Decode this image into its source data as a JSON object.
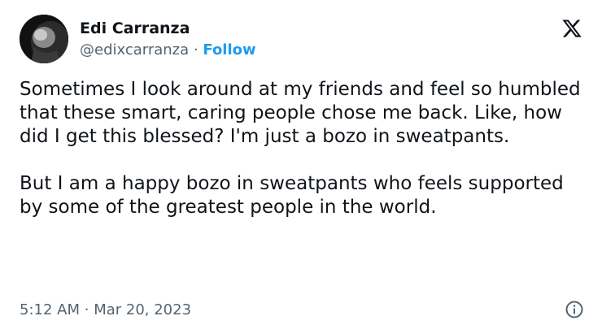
{
  "author": {
    "display_name": "Edi Carranza",
    "handle": "@edixcarranza",
    "separator": "·",
    "follow_label": "Follow",
    "avatar_icon": "profile-photo"
  },
  "brand": {
    "logo_icon": "x-logo-icon"
  },
  "tweet": {
    "paragraph_1": "Sometimes I look around at my friends and feel so humbled that these smart, caring people chose me back. Like, how did I get this blessed? I'm just a bozo in sweatpants.",
    "paragraph_2": "But I am a happy bozo in sweatpants who feels supported by some of the greatest people in the world."
  },
  "footer": {
    "time": "5:12 AM",
    "separator": "·",
    "date": "Mar 20, 2023",
    "info_icon": "info-icon"
  },
  "colors": {
    "text_primary": "#0f1419",
    "text_secondary": "#536471",
    "accent": "#1d9bf0",
    "background": "#ffffff"
  }
}
